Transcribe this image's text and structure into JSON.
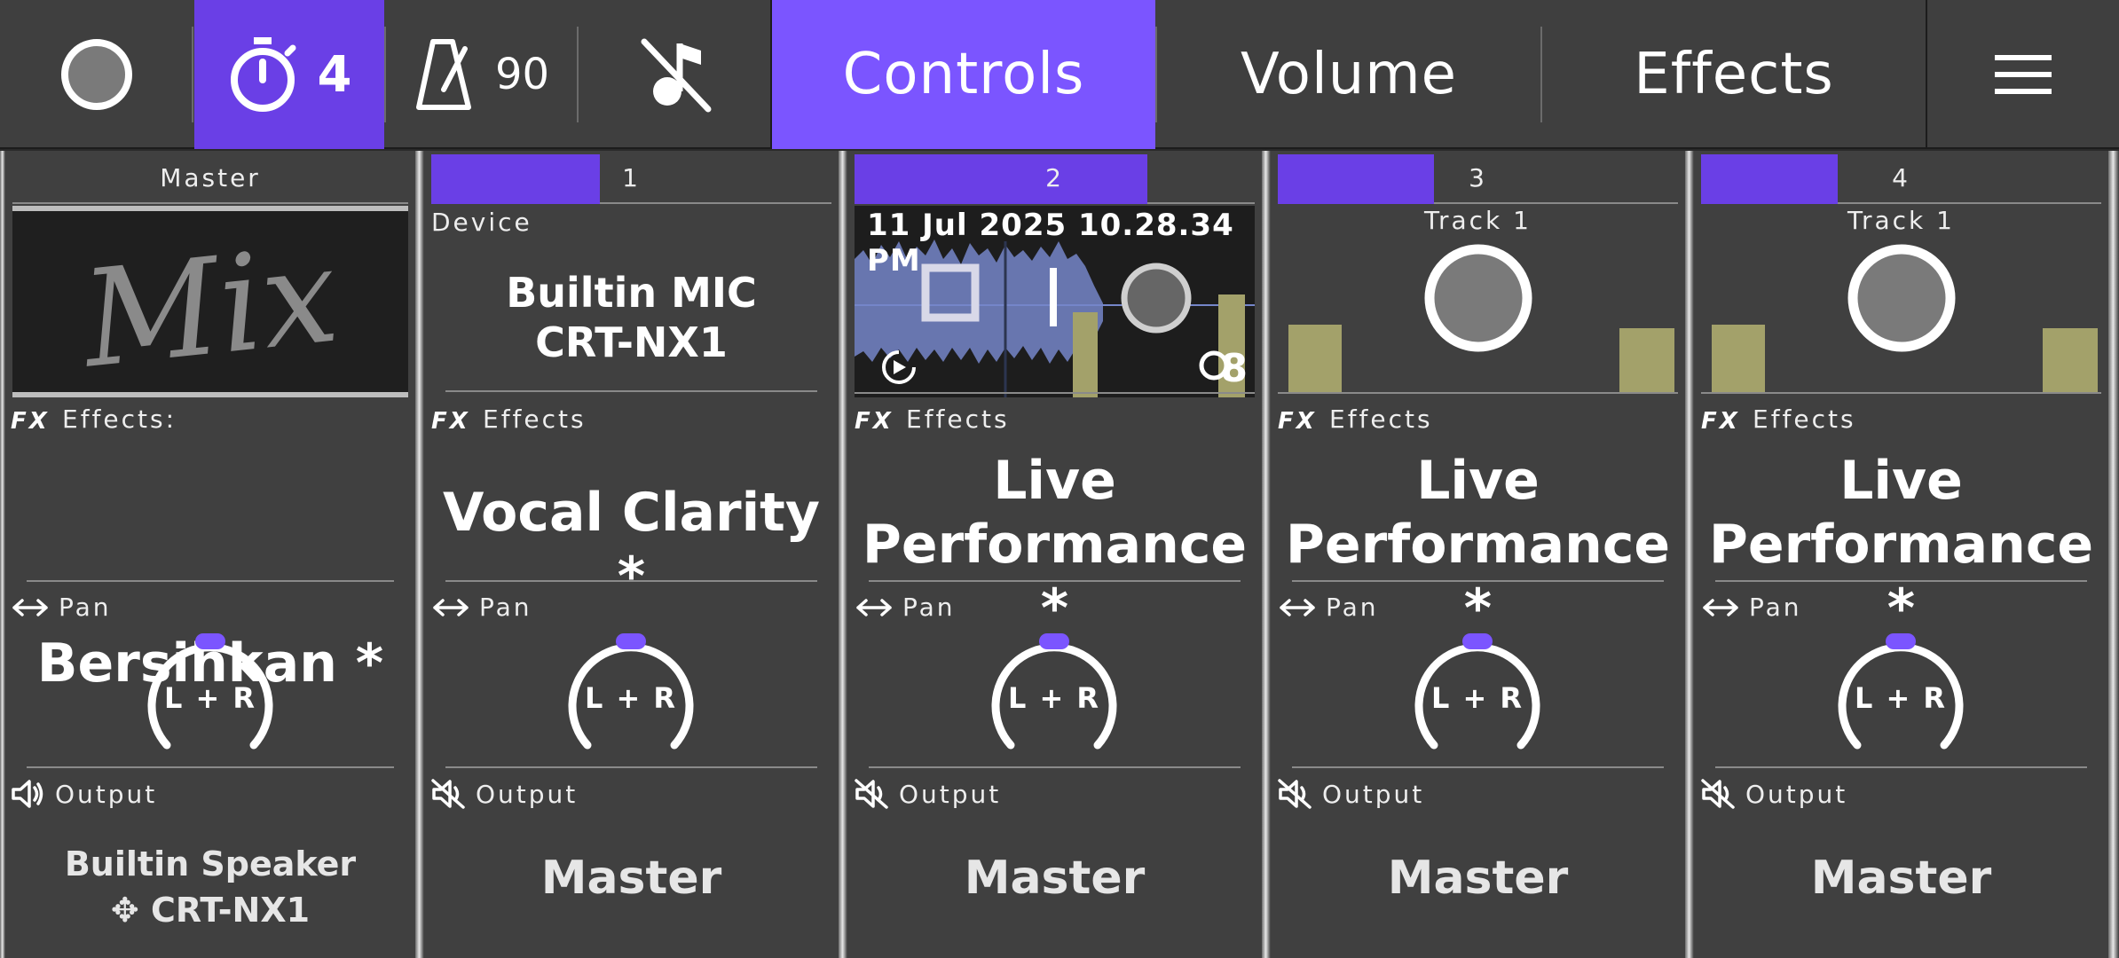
{
  "toolbar": {
    "count_in": "4",
    "tempo": "90",
    "tabs": [
      "Controls",
      "Volume",
      "Effects"
    ],
    "active_tab": "Controls",
    "accent": "#7b55ff"
  },
  "channels": [
    {
      "header": "Master",
      "mix_label": "Mix",
      "effects_label": "Effects:",
      "effect": "Bersihkan *",
      "pan_label": "Pan",
      "pan_value": "L + R",
      "output_label": "Output",
      "output_line1": "Builtin Speaker",
      "output_line2": "CRT-NX1"
    },
    {
      "header": "1",
      "device_label": "Device",
      "device_line1": "Builtin MIC",
      "device_line2": "CRT-NX1",
      "effects_label": "Effects",
      "effect": "Vocal Clarity *",
      "pan_label": "Pan",
      "pan_value": "L + R",
      "output_label": "Output",
      "output": "Master"
    },
    {
      "header": "2",
      "timestamp": "11 Jul 2025 10.28.34 PM",
      "beat_count": "8",
      "effects_label": "Effects",
      "effect_line1": "Live",
      "effect_line2": "Performance *",
      "pan_label": "Pan",
      "pan_value": "L + R",
      "output_label": "Output",
      "output": "Master"
    },
    {
      "header": "3",
      "track_label": "Track 1",
      "effects_label": "Effects",
      "effect_line1": "Live",
      "effect_line2": "Performance *",
      "pan_label": "Pan",
      "pan_value": "L + R",
      "output_label": "Output",
      "output": "Master"
    },
    {
      "header": "4",
      "track_label": "Track 1",
      "effects_label": "Effects",
      "effect_line1": "Live",
      "effect_line2": "Performance *",
      "pan_label": "Pan",
      "pan_value": "L + R",
      "output_label": "Output",
      "output": "Master"
    }
  ]
}
